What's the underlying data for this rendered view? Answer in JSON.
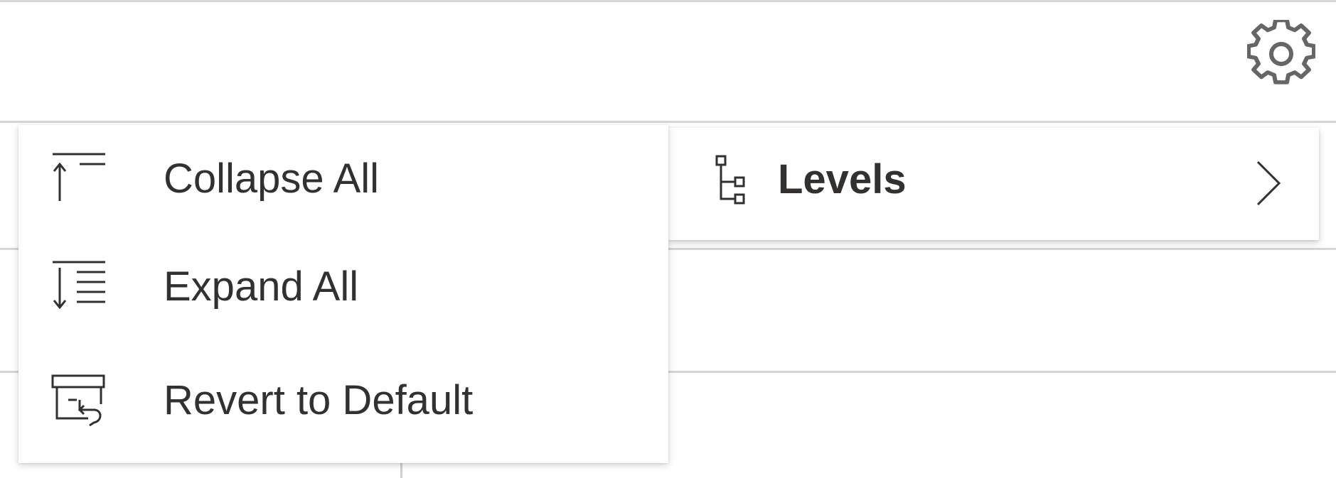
{
  "toolbar": {
    "settings_icon": "gear-icon"
  },
  "context_menu": {
    "items": [
      {
        "label": "Collapse All",
        "icon": "collapse-all-icon"
      },
      {
        "label": "Expand All",
        "icon": "expand-all-icon"
      },
      {
        "label": "Revert to Default",
        "icon": "revert-to-default-icon"
      }
    ]
  },
  "submenu": {
    "label": "Levels",
    "icon": "hierarchy-levels-icon",
    "chevron_icon": "chevron-right-icon"
  },
  "colors": {
    "text": "#323130",
    "icon": "#666666",
    "divider": "#d6d6d6",
    "menu_bg": "#ffffff"
  }
}
